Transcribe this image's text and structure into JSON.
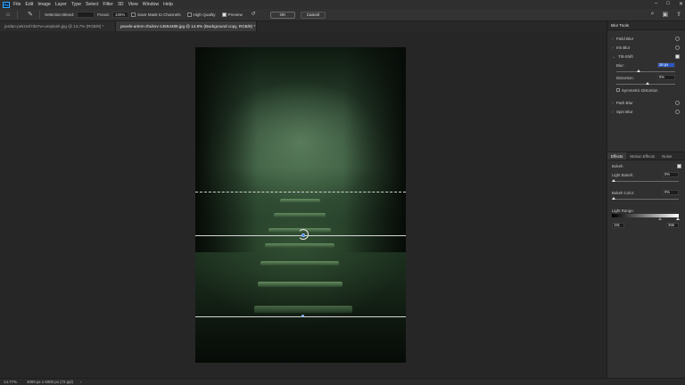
{
  "menu": {
    "logo": "Ps",
    "items": [
      "File",
      "Edit",
      "Image",
      "Layer",
      "Type",
      "Select",
      "Filter",
      "3D",
      "View",
      "Window",
      "Help"
    ]
  },
  "options": {
    "selection_bleed_label": "Selection Bleed:",
    "focus_label": "Focus:",
    "focus_value": "100%",
    "save_mask_label": "Save Mask to Channels",
    "high_quality_label": "High Quality",
    "preview_label": "Preview",
    "ok_label": "OK",
    "cancel_label": "Cancel"
  },
  "tabs": [
    {
      "label": "jordan-pekrzel7d67w-unsplash.jpg @ 13.7% (RGB/8) *",
      "active": false
    },
    {
      "label": "pexels-artem-zhukov-14554489.jpg @ 14.9% (Background copy, RGB/8) *",
      "active": true
    }
  ],
  "blur_tools": {
    "title": "Blur Tools",
    "items": [
      {
        "label": "Field Blur",
        "checked": false
      },
      {
        "label": "Iris Blur",
        "checked": false
      },
      {
        "label": "Tilt-Shift",
        "checked": true
      },
      {
        "label": "Path Blur",
        "checked": false
      },
      {
        "label": "Spin Blur",
        "checked": false
      }
    ],
    "tilt_shift": {
      "blur_label": "Blur:",
      "blur_value": "26 px",
      "distortion_label": "Distortion:",
      "distortion_value": "0%",
      "symmetric_label": "Symmetric Distortion"
    }
  },
  "effects": {
    "tabs": [
      "Effects",
      "Motion Effects",
      "Noise"
    ],
    "bokeh_label": "Bokeh",
    "light_bokeh_label": "Light Bokeh:",
    "light_bokeh_value": "0%",
    "bokeh_color_label": "Bokeh Color:",
    "bokeh_color_value": "0%",
    "light_range_label": "Light Range:",
    "light_range_low": "191",
    "light_range_high": "255"
  },
  "status": {
    "zoom": "14.77%",
    "doc_info": "4000 px x 6000 px (72 ppi)",
    "arrow": "›"
  },
  "colors": {
    "accent": "#2f73ff",
    "selection": "#2b57c8"
  }
}
